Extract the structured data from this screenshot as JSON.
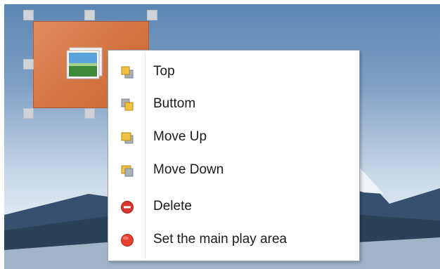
{
  "context_menu": {
    "items": [
      {
        "label": "Top",
        "icon": "bring-to-top-icon"
      },
      {
        "label": "Buttom",
        "icon": "send-to-bottom-icon"
      },
      {
        "label": "Move Up",
        "icon": "move-up-icon"
      },
      {
        "label": "Move Down",
        "icon": "move-down-icon"
      },
      {
        "label": "Delete",
        "icon": "delete-icon"
      },
      {
        "label": "Set the main play area",
        "icon": "main-area-icon"
      }
    ]
  },
  "colors": {
    "selection_fill": "#d2733f",
    "delete_red": "#d9342b",
    "layer_gold": "#f0c040",
    "layer_gray": "#a9b0b8"
  }
}
